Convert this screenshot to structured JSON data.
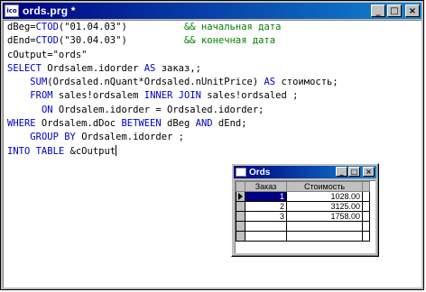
{
  "window": {
    "title": "ords.prg *",
    "icon_label": "ico",
    "buttons": {
      "minimize": "_",
      "maximize": "□",
      "close": "×"
    }
  },
  "editor": {
    "lines": [
      {
        "parts": [
          {
            "t": "dBeg=",
            "c": ""
          },
          {
            "t": "CTOD",
            "c": "kw"
          },
          {
            "t": "(\"01.04.03\")          ",
            "c": ""
          },
          {
            "t": "&& начальная дата",
            "c": "cm"
          }
        ]
      },
      {
        "parts": [
          {
            "t": "dEnd=",
            "c": ""
          },
          {
            "t": "CTOD",
            "c": "kw"
          },
          {
            "t": "(\"30.04.03\")          ",
            "c": ""
          },
          {
            "t": "&& конечная дата",
            "c": "cm"
          }
        ]
      },
      {
        "parts": [
          {
            "t": "cOutput=\"ords\"",
            "c": ""
          }
        ]
      },
      {
        "parts": [
          {
            "t": "SELECT",
            "c": "kw"
          },
          {
            "t": " Ordsalem.idorder ",
            "c": ""
          },
          {
            "t": "AS",
            "c": "kw"
          },
          {
            "t": " заказ,;",
            "c": ""
          }
        ]
      },
      {
        "parts": [
          {
            "t": "    ",
            "c": ""
          },
          {
            "t": "SUM",
            "c": "kw"
          },
          {
            "t": "(Ordsaled.nQuant*Ordsaled.nUnitPrice) ",
            "c": ""
          },
          {
            "t": "AS",
            "c": "kw"
          },
          {
            "t": " стоимость;",
            "c": ""
          }
        ]
      },
      {
        "parts": [
          {
            "t": "    ",
            "c": ""
          },
          {
            "t": "FROM",
            "c": "kw"
          },
          {
            "t": " sales!ordsalem ",
            "c": ""
          },
          {
            "t": "INNER JOIN",
            "c": "kw"
          },
          {
            "t": " sales!ordsaled ;",
            "c": ""
          }
        ]
      },
      {
        "parts": [
          {
            "t": "      ",
            "c": ""
          },
          {
            "t": "ON",
            "c": "kw"
          },
          {
            "t": " Ordsalem.idorder = Ordsaled.idorder;",
            "c": ""
          }
        ]
      },
      {
        "parts": [
          {
            "t": "WHERE",
            "c": "kw"
          },
          {
            "t": " Ordsalem.dDoc ",
            "c": ""
          },
          {
            "t": "BETWEEN",
            "c": "kw"
          },
          {
            "t": " dBeg ",
            "c": ""
          },
          {
            "t": "AND",
            "c": "kw"
          },
          {
            "t": " dEnd;",
            "c": ""
          }
        ]
      },
      {
        "parts": [
          {
            "t": "    ",
            "c": ""
          },
          {
            "t": "GROUP BY",
            "c": "kw"
          },
          {
            "t": " Ordsalem.idorder ;",
            "c": ""
          }
        ]
      },
      {
        "parts": [
          {
            "t": "INTO TABLE",
            "c": "kw"
          },
          {
            "t": " &cOutput",
            "c": ""
          }
        ]
      }
    ]
  },
  "browse": {
    "title": "Ords",
    "buttons": {
      "minimize": "_",
      "maximize": "□",
      "close": "×"
    },
    "columns": [
      "Заказ",
      "Стоимость"
    ],
    "rows": [
      {
        "zakaz": "1",
        "cost": "1028.00",
        "selected": true
      },
      {
        "zakaz": "2",
        "cost": "3125.00",
        "selected": false
      },
      {
        "zakaz": "3",
        "cost": "1758.00",
        "selected": false
      },
      {
        "zakaz": "",
        "cost": "",
        "selected": false
      },
      {
        "zakaz": "",
        "cost": "",
        "selected": false
      }
    ]
  }
}
